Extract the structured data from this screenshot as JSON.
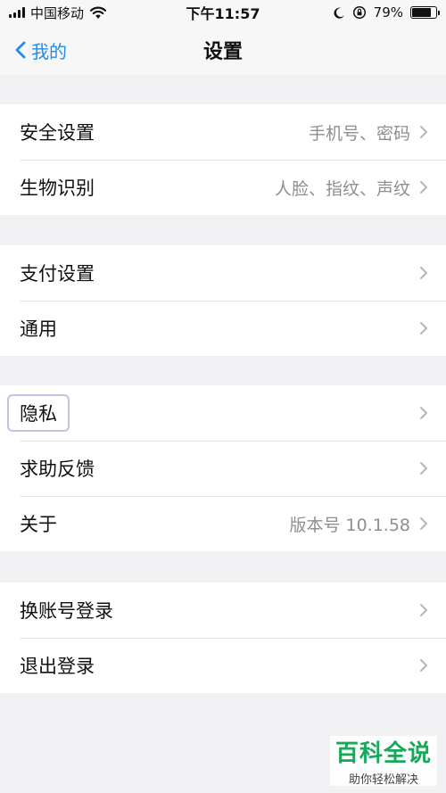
{
  "status_bar": {
    "carrier": "中国移动",
    "time": "下午11:57",
    "battery_percent": "79%",
    "battery_level": 0.79,
    "icons": [
      "signal-icon",
      "wifi-icon",
      "moon-icon",
      "orientation-lock-icon",
      "battery-icon"
    ]
  },
  "nav": {
    "back_label": "我的",
    "title": "设置"
  },
  "groups": [
    {
      "rows": [
        {
          "label": "安全设置",
          "value": "手机号、密码"
        },
        {
          "label": "生物识别",
          "value": "人脸、指纹、声纹"
        }
      ]
    },
    {
      "rows": [
        {
          "label": "支付设置",
          "value": ""
        },
        {
          "label": "通用",
          "value": ""
        }
      ]
    },
    {
      "rows": [
        {
          "label": "隐私",
          "value": ""
        },
        {
          "label": "求助反馈",
          "value": ""
        },
        {
          "label": "关于",
          "value": "版本号 10.1.58"
        }
      ]
    },
    {
      "rows": [
        {
          "label": "换账号登录",
          "value": ""
        },
        {
          "label": "退出登录",
          "value": ""
        }
      ]
    }
  ],
  "watermark": {
    "title": "百科全说",
    "subtitle": "助你轻松解决"
  },
  "colors": {
    "accent": "#1e8cf0",
    "background": "#f1f1f3",
    "secondary_text": "#8e8e93",
    "highlight_border": "#c6c0e2",
    "watermark_green": "#18a85a"
  }
}
